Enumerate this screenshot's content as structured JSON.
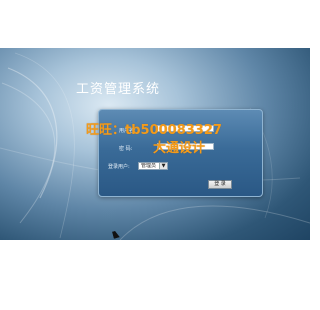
{
  "app": {
    "title": "工资管理系统"
  },
  "login": {
    "username_label": "用户名:",
    "password_label": "密 码:",
    "user_type_label": "登录用户:",
    "user_type_selected": "管理员",
    "login_button": "登 录"
  },
  "watermark": {
    "line1": "旺旺：tb500083327",
    "line2": "大通设计"
  },
  "colors": {
    "background_dark": "#1f4463",
    "panel": "#3a6b98",
    "watermark": "#f39b1a"
  }
}
